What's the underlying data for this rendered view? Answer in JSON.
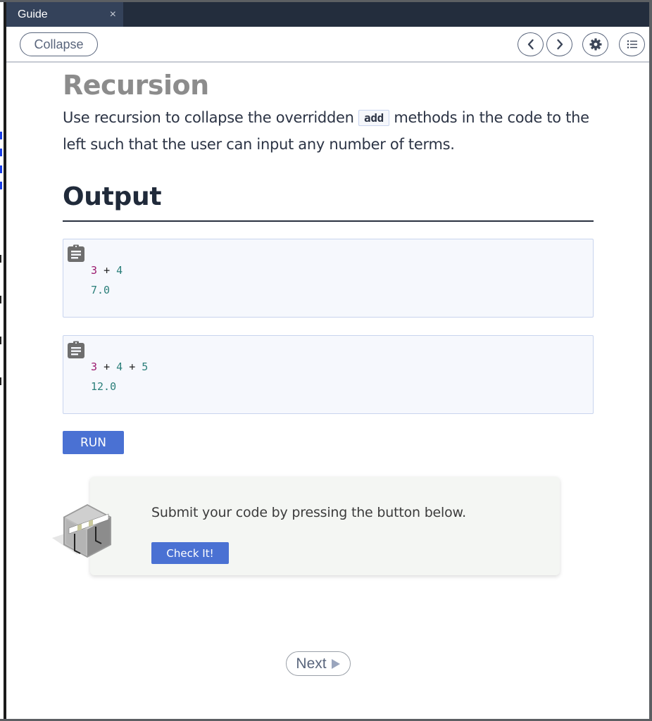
{
  "tab": {
    "label": "Guide",
    "close_glyph": "×"
  },
  "toolbar": {
    "collapse_label": "Collapse",
    "icons": [
      "chevron-left-icon",
      "chevron-right-icon",
      "gear-icon",
      "list-icon"
    ]
  },
  "guide": {
    "title": "Recursion",
    "description_before": "Use recursion to collapse the overridden ",
    "inline_code": "add",
    "description_after": " methods in the code to the left such that the user can input any number of terms.",
    "output_heading": "Output"
  },
  "outputs": [
    {
      "input": {
        "first": "3",
        "rest": [
          {
            "op": "+",
            "num": "4"
          }
        ]
      },
      "result": "7.0"
    },
    {
      "input": {
        "first": "3",
        "rest": [
          {
            "op": "+",
            "num": "4"
          },
          {
            "op": "+",
            "num": "5"
          }
        ]
      },
      "result": "12.0"
    }
  ],
  "run_label": "RUN",
  "check": {
    "message": "Submit your code by pressing the button below.",
    "button_label": "Check It!"
  },
  "next_label": "Next",
  "colors": {
    "accent": "#4a71d3",
    "tabbar": "#232d3d",
    "tab_active": "#34425a",
    "code_first_num": "#9b1a6e",
    "code_num": "#2b7f7a"
  }
}
